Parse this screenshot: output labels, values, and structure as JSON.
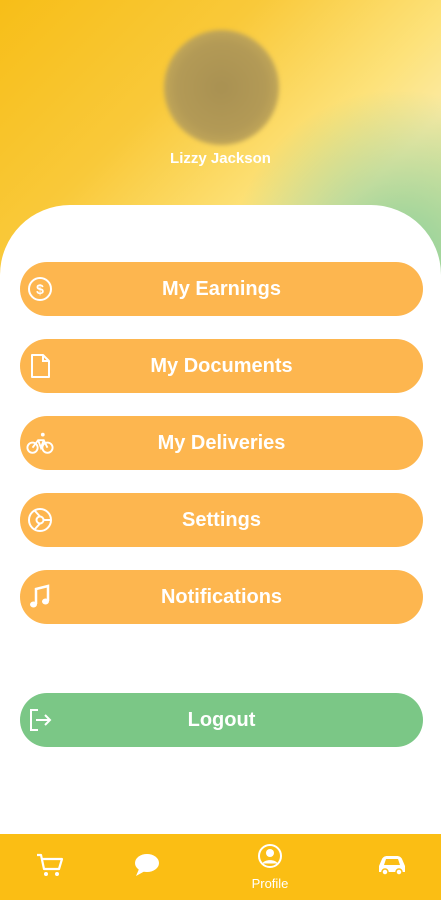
{
  "profile": {
    "name": "Lizzy Jackson"
  },
  "menu": [
    {
      "label": "My Earnings",
      "icon": "dollar-icon"
    },
    {
      "label": "My Documents",
      "icon": "document-icon"
    },
    {
      "label": "My Deliveries",
      "icon": "bicycle-icon"
    },
    {
      "label": "Settings",
      "icon": "settings-icon"
    },
    {
      "label": "Notifications",
      "icon": "music-note-icon"
    }
  ],
  "logout": {
    "label": "Logout",
    "icon": "logout-icon"
  },
  "tabbar": {
    "tabs": [
      {
        "icon": "cart-icon",
        "label": ""
      },
      {
        "icon": "chat-icon",
        "label": ""
      },
      {
        "icon": "profile-icon",
        "label": "Profile"
      },
      {
        "icon": "car-icon",
        "label": ""
      }
    ]
  },
  "colors": {
    "menu": "#fdb64f",
    "logout": "#7bc786",
    "tabbar": "#fbbe14"
  }
}
